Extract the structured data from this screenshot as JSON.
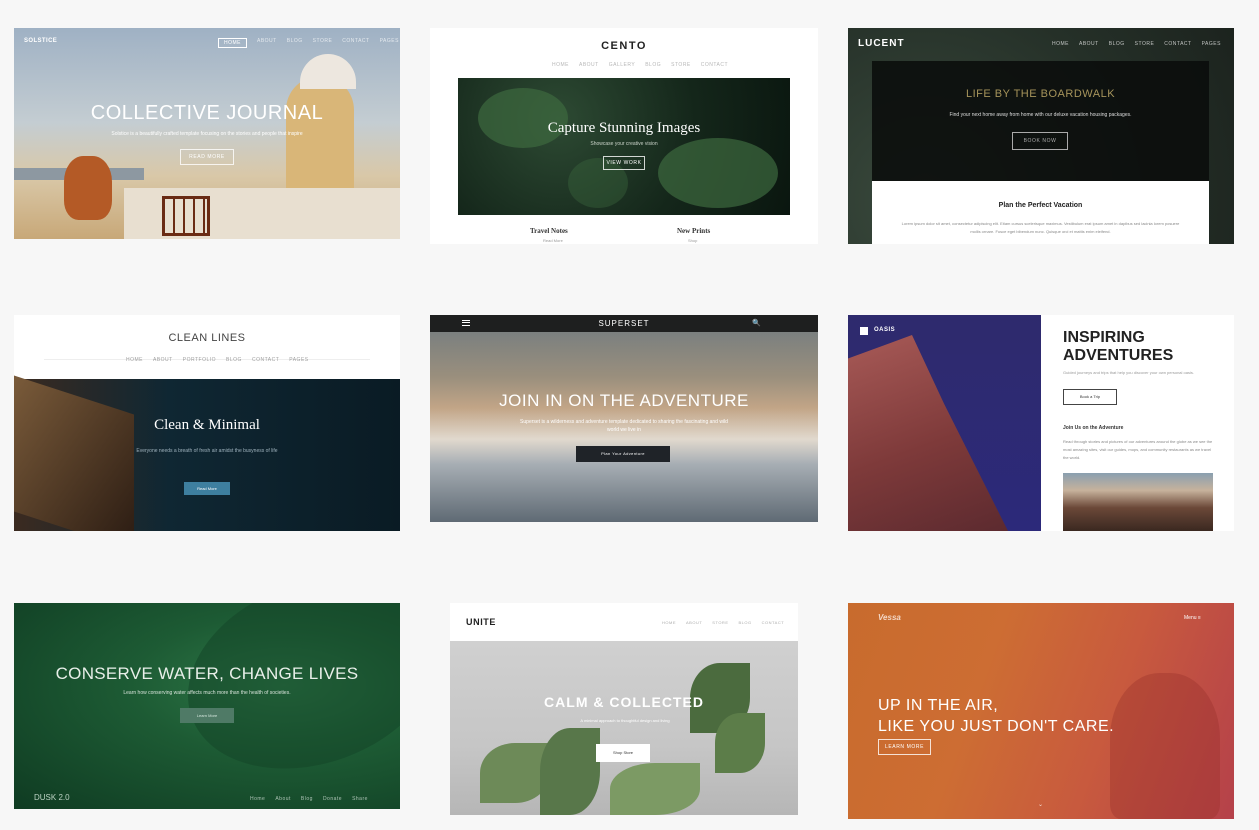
{
  "cards": [
    {
      "logo": "SOLSTICE",
      "nav": [
        "Home",
        "About",
        "Blog",
        "Store",
        "Contact",
        "Pages"
      ],
      "title": "COLLECTIVE JOURNAL",
      "subtitle": "Solstice is a beautifully crafted template focusing on the stories and people that inspire",
      "button": "Read More"
    },
    {
      "logo": "CENTO",
      "nav": [
        "Home",
        "About",
        "Gallery",
        "Blog",
        "Store",
        "Contact"
      ],
      "title": "Capture Stunning Images",
      "subtitle": "Showcase your creative vision",
      "button": "View Work",
      "col_left": "Travel Notes",
      "col_right": "New Prints",
      "col_left_meta": "Read More",
      "col_right_meta": "Shop"
    },
    {
      "logo": "LUCENT",
      "nav": [
        "Home",
        "About",
        "Blog",
        "Store",
        "Contact",
        "Pages"
      ],
      "title": "LIFE BY THE BOARDWALK",
      "subtitle": "Find your next home away from home with our deluxe vacation housing packages.",
      "button": "Book Now",
      "section_title": "Plan the Perfect Vacation",
      "section_text": "Lorem ipsum dolor sit amet, consectetur adipiscing elit. Etiam cursus scelerisque maximus. Vestibulum erat ipsum amet in dapibus sed lacinia lorem posuere mollis ornare. Fusce eget bibendum nunc. Quisque orci et mattis enim eleifend."
    },
    {
      "logo": "CLEAN LINES",
      "nav": [
        "Home",
        "About",
        "Portfolio",
        "Blog",
        "Contact",
        "Pages"
      ],
      "title": "Clean & Minimal",
      "subtitle": "Everyone needs a breath of fresh air amidst the busyness of life",
      "button": "Read More"
    },
    {
      "logo": "SUPERSET",
      "search_icon": "🔍",
      "title": "JOIN IN ON THE ADVENTURE",
      "subtitle": "Superset is a wilderness and adventure template dedicated to sharing the fascinating and wild world we live in",
      "button": "Plan Your Adventure"
    },
    {
      "logo": "OASIS",
      "title_line1": "INSPIRING",
      "title_line2": "ADVENTURES",
      "intro": "Guided journeys and trips that help you discover your own personal oasis.",
      "button": "Book a Trip",
      "section_title": "Join Us on the Adventure",
      "section_text": "Read through stories and pictures of our adventures around the globe as we see the most amazing sites, visit our guides, mops, and community restaurants as we travel the world."
    },
    {
      "title": "CONSERVE WATER, CHANGE LIVES",
      "subtitle": "Learn how conserving water affects much more than the health of societies.",
      "button": "Learn More",
      "footer_logo": "DUSK 2.0",
      "nav": [
        "Home",
        "About",
        "Blog",
        "Donate",
        "Share"
      ]
    },
    {
      "logo": "UNITE",
      "nav": [
        "Home",
        "About",
        "Store",
        "Blog",
        "Contact"
      ],
      "title": "CALM & COLLECTED",
      "subtitle": "A minimal approach to thoughtful design and living",
      "button": "Shop Store"
    },
    {
      "logo": "Vessa",
      "menu": "Menu ≡",
      "title_line1": "UP IN THE AIR,",
      "title_line2": "LIKE YOU JUST DON'T CARE.",
      "button": "Learn More",
      "scroll_icon": "⌄"
    }
  ]
}
